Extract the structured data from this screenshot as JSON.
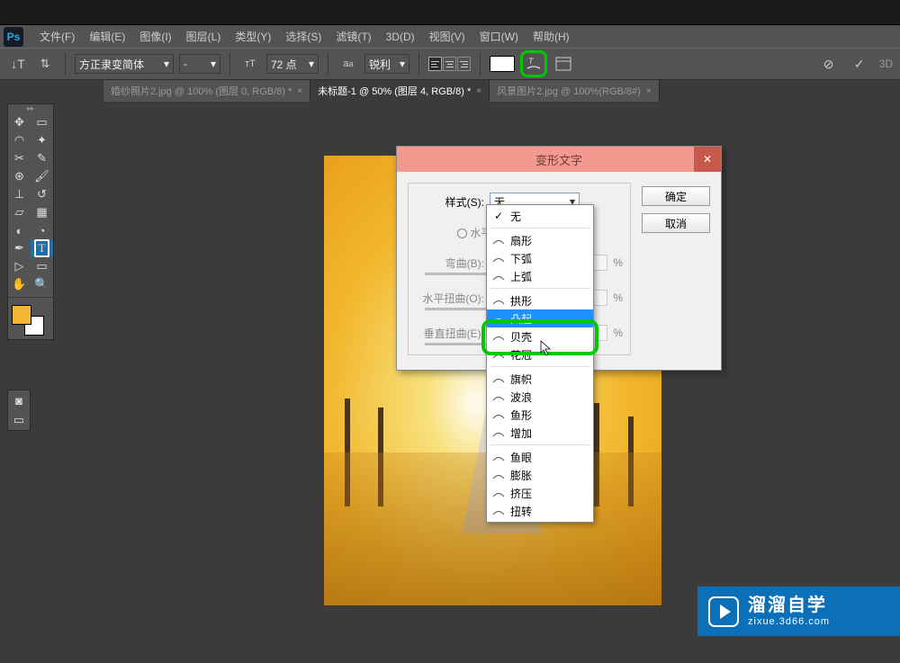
{
  "menus": [
    "文件(F)",
    "编辑(E)",
    "图像(I)",
    "图层(L)",
    "类型(Y)",
    "选择(S)",
    "滤镜(T)",
    "3D(D)",
    "视图(V)",
    "窗口(W)",
    "帮助(H)"
  ],
  "options": {
    "font_family": "方正隶变简体",
    "font_style": "-",
    "font_size": "72 点",
    "aa_mode": "锐利",
    "three_d_label": "3D"
  },
  "tabs": [
    {
      "label": "婚纱照片2.jpg @ 100% (图层 0, RGB/8) *",
      "active": false
    },
    {
      "label": "未标题-1 @ 50% (图层 4, RGB/8) *",
      "active": true
    },
    {
      "label": "风景图片2.jpg @ 100%(RGB/8#)",
      "active": false
    }
  ],
  "dialog": {
    "title": "变形文字",
    "style_label": "样式(S):",
    "style_value": "无",
    "orient_h": "水平",
    "bend_label": "弯曲(B):",
    "hdist_label": "水平扭曲(O):",
    "vdist_label": "垂直扭曲(E):",
    "pct": "%",
    "ok": "确定",
    "cancel": "取消"
  },
  "dropdown_groups": [
    [
      {
        "label": "无",
        "check": true
      }
    ],
    [
      {
        "label": "扇形"
      },
      {
        "label": "下弧"
      },
      {
        "label": "上弧"
      }
    ],
    [
      {
        "label": "拱形"
      },
      {
        "label": "凸起",
        "selected": true
      },
      {
        "label": "贝壳"
      },
      {
        "label": "花冠"
      }
    ],
    [
      {
        "label": "旗帜"
      },
      {
        "label": "波浪"
      },
      {
        "label": "鱼形"
      },
      {
        "label": "增加"
      }
    ],
    [
      {
        "label": "鱼眼"
      },
      {
        "label": "膨胀"
      },
      {
        "label": "挤压"
      },
      {
        "label": "扭转"
      }
    ]
  ],
  "watermark": {
    "main": "溜溜自学",
    "sub": "zixue.3d66.com"
  }
}
